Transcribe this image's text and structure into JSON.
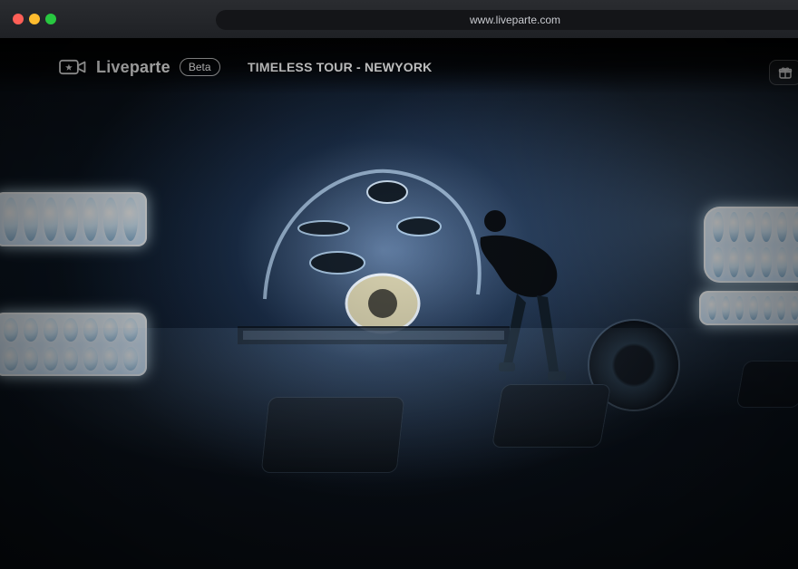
{
  "browser": {
    "url": "www.liveparte.com"
  },
  "app": {
    "brand_name": "Liveparte",
    "beta_label": "Beta",
    "event_title": "TIMELESS TOUR - NEWYORK"
  },
  "icons": {
    "brand": "video-camera-star-icon",
    "gift": "gift-icon"
  },
  "colors": {
    "titlebar": "#1f2125",
    "urlbar": "#141518",
    "traffic_red": "#ff5f57",
    "traffic_yellow": "#febc2e",
    "traffic_green": "#28c840",
    "stage_glow": "#a0c8ff"
  }
}
